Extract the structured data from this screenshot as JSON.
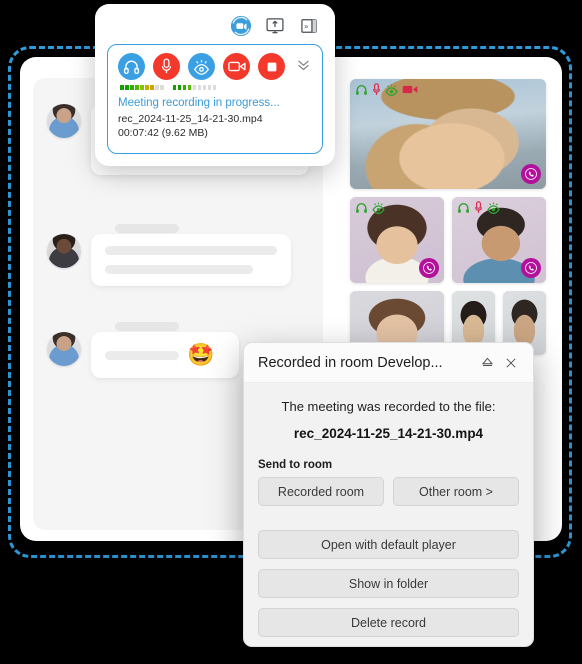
{
  "recording_widget": {
    "top_buttons": [
      {
        "name": "record-toggle-icon",
        "label": "Record"
      },
      {
        "name": "screen-share-icon",
        "label": "Share screen"
      },
      {
        "name": "panel-toggle-icon",
        "label": "Collapse panel"
      }
    ],
    "controls": [
      {
        "name": "headphones-icon",
        "label": "Speakers",
        "color": "#3aa0e3"
      },
      {
        "name": "microphone-icon",
        "label": "Microphone",
        "color": "#f5382c"
      },
      {
        "name": "eye-icon",
        "label": "Visibility",
        "color": "#3aa0e3"
      },
      {
        "name": "camera-icon",
        "label": "Camera",
        "color": "#f5382c"
      },
      {
        "name": "stop-icon",
        "label": "Stop recording",
        "color": "#f5382c"
      }
    ],
    "collapse_label": "Collapse",
    "status_text": "Meeting recording in progress...",
    "file_name": "rec_2024-11-25_14-21-30.mp4",
    "file_meta": "00:07:42 (9.62 MB)",
    "meters": [
      {
        "name": "speaker-level-meter",
        "segments": 9,
        "lit": 7
      },
      {
        "name": "mic-level-meter",
        "segments": 9,
        "lit": 4
      }
    ],
    "colors": {
      "accent_blue": "#3aa0e3",
      "accent_red": "#f5382c",
      "status_blue": "#3a9ad9"
    }
  },
  "dialog": {
    "title": "Recorded in room Develop...",
    "minimize_label": "Eject",
    "close_label": "Close",
    "message": "The meeting was recorded to the file:",
    "file_name": "rec_2024-11-25_14-21-30.mp4",
    "send_to_room_label": "Send to room",
    "buttons": {
      "recorded_room": "Recorded room",
      "other_room": "Other room >",
      "open_player": "Open with default player",
      "show_in_folder": "Show in folder",
      "delete_record": "Delete record"
    }
  },
  "chat": {
    "messages": [
      {
        "name": "chat-message-1",
        "lines": 3,
        "emoji": ""
      },
      {
        "name": "chat-message-2",
        "lines": 2,
        "emoji": ""
      },
      {
        "name": "chat-message-3",
        "lines": 1,
        "emoji": "🤩"
      }
    ]
  },
  "video_grid": {
    "tiles": [
      {
        "name": "video-tile-main",
        "icons": [
          "headphones",
          "mic-muted",
          "eye",
          "camera-off"
        ],
        "call_badge": true
      },
      {
        "name": "video-tile-2",
        "icons": [
          "headphones",
          "eye"
        ],
        "call_badge": true
      },
      {
        "name": "video-tile-3",
        "icons": [
          "headphones",
          "mic-muted",
          "eye"
        ],
        "call_badge": true
      },
      {
        "name": "video-tile-4",
        "icons": [],
        "call_badge": false
      },
      {
        "name": "video-tile-5",
        "icons": [],
        "call_badge": false
      },
      {
        "name": "video-tile-6",
        "icons": [],
        "call_badge": false
      }
    ],
    "colors": {
      "icon_green": "#2ea32e",
      "icon_red": "#d6294a",
      "badge_purple": "#b3109c"
    }
  },
  "frame": {
    "highlight_color": "#2f9fe0"
  }
}
